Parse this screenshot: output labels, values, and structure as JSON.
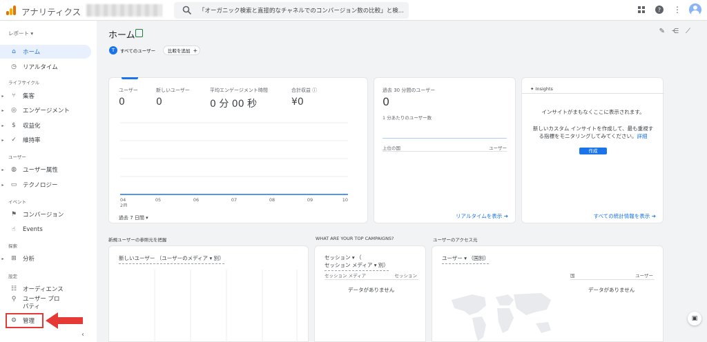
{
  "topbar": {
    "app_title": "アナリティクス",
    "search_placeholder": "「オーガニック検索と直接的なチャネルでのコンバージョン数の比較」と検..."
  },
  "sidebar": {
    "property_select": "レポート",
    "items": [
      {
        "label": "ホーム",
        "icon": "home-icon",
        "active": true
      },
      {
        "label": "リアルタイム",
        "icon": "clock-icon"
      },
      {
        "section": "ライフサイクル"
      },
      {
        "label": "集客",
        "icon": "acquisition-icon",
        "caret": true
      },
      {
        "label": "エンゲージメント",
        "icon": "engagement-icon",
        "caret": true
      },
      {
        "label": "収益化",
        "icon": "monetization-icon",
        "caret": true
      },
      {
        "label": "維持率",
        "icon": "retention-icon",
        "caret": true
      },
      {
        "section": "ユーザー"
      },
      {
        "label": "ユーザー属性",
        "icon": "globe-icon",
        "caret": true
      },
      {
        "label": "テクノロジー",
        "icon": "device-icon",
        "caret": true
      },
      {
        "section": "イベント"
      },
      {
        "label": "コンバージョン",
        "icon": "flag-icon"
      },
      {
        "label": "Events",
        "icon": "touch-icon"
      },
      {
        "section": "探索"
      },
      {
        "label": "分析",
        "icon": "explore-icon",
        "caret": true
      },
      {
        "section": "設定"
      },
      {
        "label": "オーディエンス",
        "icon": "audience-icon"
      },
      {
        "label": "ユーザー プロパティ",
        "icon": "user-property-icon"
      },
      {
        "label": "管理",
        "icon": "gear-icon"
      }
    ],
    "highlight_color": "#e53935"
  },
  "header": {
    "title": "ホーム",
    "audience_chip": "すべてのユーザー",
    "audience_chip_initial": "T",
    "compare_chip": "比較を追加"
  },
  "overview": {
    "metrics": [
      {
        "label": "ユーザー",
        "value": "0"
      },
      {
        "label": "新しいユーザー",
        "value": "0"
      },
      {
        "label": "平均エンゲージメント時間",
        "value": "0 分 00 秒"
      },
      {
        "label": "合計収益",
        "value": "¥0"
      }
    ],
    "period": "過去 7 日間",
    "x_labels": [
      "04",
      "05",
      "06",
      "07",
      "08",
      "09",
      "10"
    ],
    "x_month": "2月"
  },
  "realtime": {
    "title": "過去 30 分間のユーザー",
    "value": "0",
    "subtitle": "1 分あたりのユーザー数",
    "col_country": "上位の国",
    "col_users": "ユーザー",
    "link": "リアルタイムを表示"
  },
  "insights": {
    "header": "Insights",
    "msg1": "インサイトがまもなくここに表示されます。",
    "msg2": "新しいカスタム インサイトを作成して、最も重視す",
    "msg3": "る指標をモニタリングしてみてください。",
    "msg_link": "詳細",
    "button": "作成",
    "link": "すべての統計情報を表示"
  },
  "bottom": {
    "sec1_title": "新規ユーザーの参照元を把握",
    "sec1_dropdown": "新しいユーザー （ユーザーのメディア ▾ 別）",
    "sec2_title": "WHAT ARE YOUR TOP CAMPAIGNS?",
    "sec2_dd1": "セッション ▾ （",
    "sec2_dd2": "セッション メディア ▾ 別）",
    "sec2_col1": "セッション メディア",
    "sec2_col2": "セッション",
    "sec2_nodata": "データがありません",
    "sec3_title": "ユーザーのアクセス元",
    "sec3_dropdown": "ユーザー ▾ （国別）",
    "sec3_col1": "国",
    "sec3_col2": "ユーザー",
    "sec3_nodata": "データがありません"
  },
  "colors": {
    "accent": "#1a73e8",
    "line": "#1a73e8"
  }
}
